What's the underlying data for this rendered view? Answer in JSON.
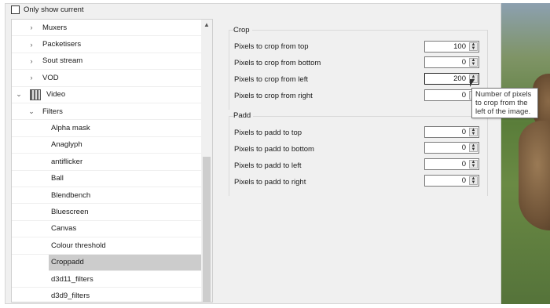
{
  "top": {
    "only_show_current": "Only show current"
  },
  "tree": {
    "items": [
      {
        "label": "Muxers",
        "indent": 1,
        "chevron": "›"
      },
      {
        "label": "Packetisers",
        "indent": 1,
        "chevron": "›"
      },
      {
        "label": "Sout stream",
        "indent": 1,
        "chevron": "›"
      },
      {
        "label": "VOD",
        "indent": 1,
        "chevron": "›"
      },
      {
        "label": "Video",
        "indent": 0,
        "chevron": "⌄"
      },
      {
        "label": "Filters",
        "indent": 1,
        "chevron": "⌄"
      },
      {
        "label": "Alpha mask",
        "indent": 2
      },
      {
        "label": "Anaglyph",
        "indent": 2
      },
      {
        "label": "antiflicker",
        "indent": 2
      },
      {
        "label": "Ball",
        "indent": 2
      },
      {
        "label": "Blendbench",
        "indent": 2
      },
      {
        "label": "Bluescreen",
        "indent": 2
      },
      {
        "label": "Canvas",
        "indent": 2
      },
      {
        "label": "Colour threshold",
        "indent": 2
      },
      {
        "label": "Croppadd",
        "indent": 2,
        "selected": true
      },
      {
        "label": "d3d11_filters",
        "indent": 2
      },
      {
        "label": "d3d9_filters",
        "indent": 2
      }
    ]
  },
  "crop": {
    "title": "Crop",
    "fields": [
      {
        "label": "Pixels to crop from top",
        "value": "100"
      },
      {
        "label": "Pixels to crop from bottom",
        "value": "0"
      },
      {
        "label": "Pixels to crop from left",
        "value": "200"
      },
      {
        "label": "Pixels to crop from right",
        "value": "0"
      }
    ]
  },
  "padd": {
    "title": "Padd",
    "fields": [
      {
        "label": "Pixels to padd to top",
        "value": "0"
      },
      {
        "label": "Pixels to padd to bottom",
        "value": "0"
      },
      {
        "label": "Pixels to padd to left",
        "value": "0"
      },
      {
        "label": "Pixels to padd to right",
        "value": "0"
      }
    ]
  },
  "tooltip": {
    "text": "Number of pixels to crop from the left of the image."
  }
}
